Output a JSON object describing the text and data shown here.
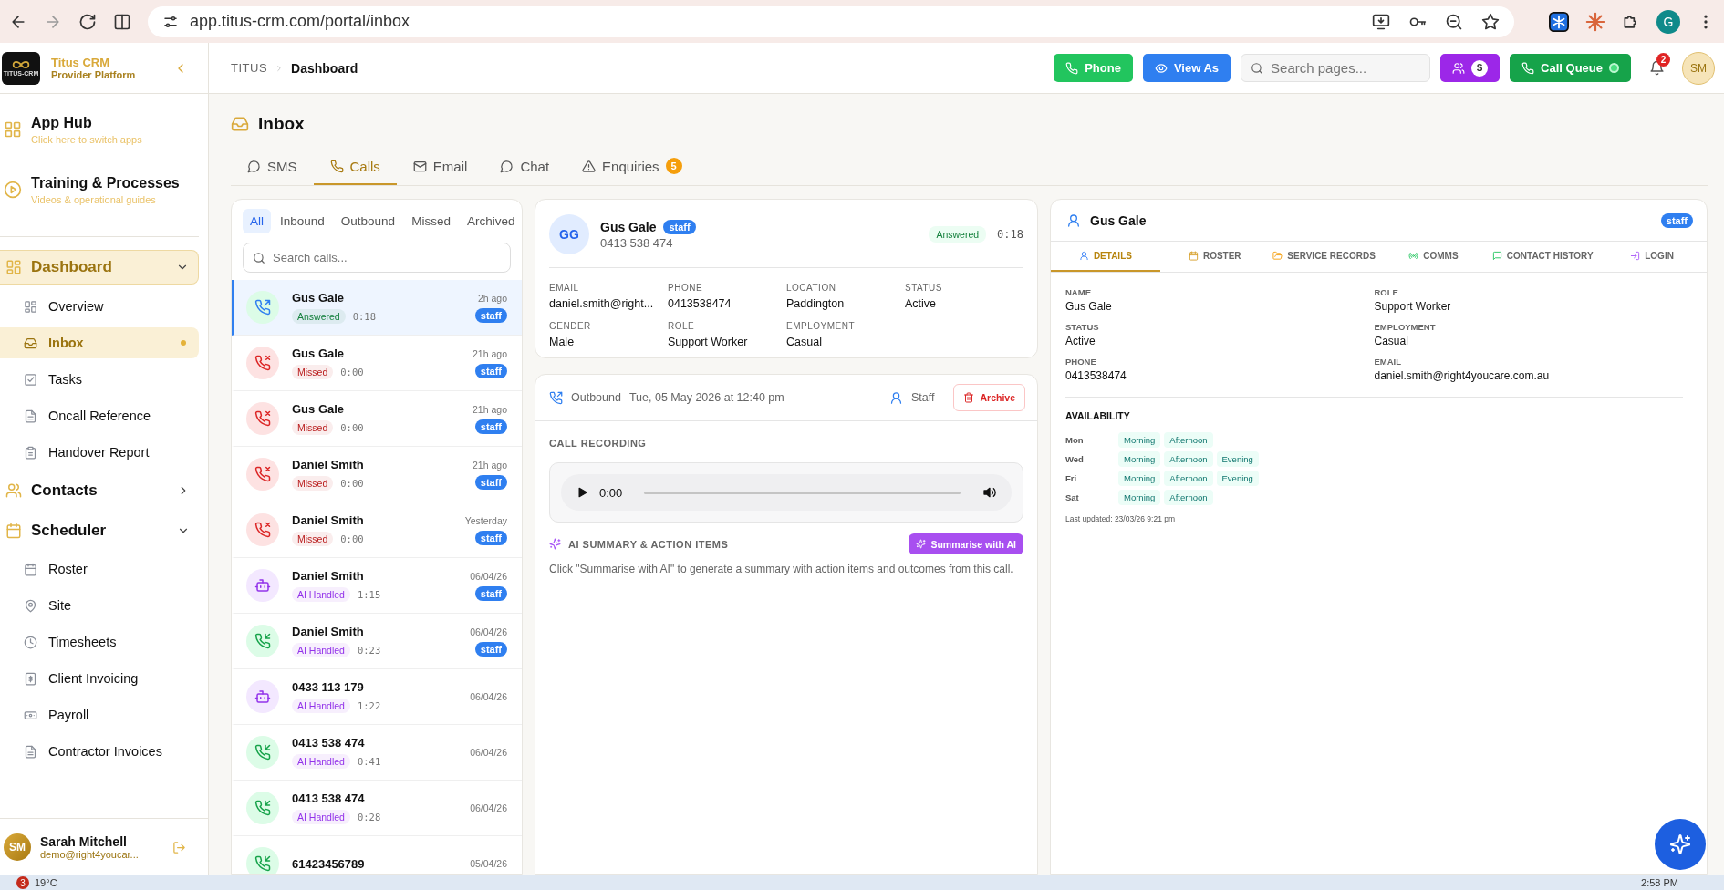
{
  "browser": {
    "url": "app.titus-crm.com/portal/inbox",
    "profile": "G"
  },
  "sidebar": {
    "logo_text": "TITUS-CRM",
    "brand": "Titus CRM",
    "subtitle": "Provider Platform",
    "apps": [
      {
        "title": "App Hub",
        "subtitle": "Click here to switch apps"
      },
      {
        "title": "Training & Processes",
        "subtitle": "Videos & operational guides"
      }
    ],
    "nav": [
      {
        "label": "Dashboard",
        "selected": true,
        "expanded": true,
        "children": [
          {
            "label": "Overview",
            "selected": false,
            "unread": false
          },
          {
            "label": "Inbox",
            "selected": true,
            "unread": true
          },
          {
            "label": "Tasks",
            "selected": false,
            "unread": false
          },
          {
            "label": "Oncall Reference",
            "selected": false,
            "unread": false
          },
          {
            "label": "Handover Report",
            "selected": false,
            "unread": false
          }
        ]
      },
      {
        "label": "Contacts",
        "selected": false,
        "expanded": false
      },
      {
        "label": "Scheduler",
        "selected": false,
        "expanded": true,
        "children": [
          {
            "label": "Roster",
            "selected": false,
            "unread": false
          },
          {
            "label": "Site",
            "selected": false,
            "unread": false
          },
          {
            "label": "Timesheets",
            "selected": false,
            "unread": false
          },
          {
            "label": "Client Invoicing",
            "selected": false,
            "unread": false
          },
          {
            "label": "Payroll",
            "selected": false,
            "unread": false
          },
          {
            "label": "Contractor Invoices",
            "selected": false,
            "unread": false
          }
        ]
      }
    ],
    "user": {
      "initials": "SM",
      "name": "Sarah Mitchell",
      "email": "demo@right4youcar..."
    }
  },
  "header": {
    "breadcrumb": [
      "TITUS",
      "Dashboard"
    ],
    "phone_button": "Phone",
    "view_as_button": "View As",
    "search": {
      "placeholder": "Search pages..."
    },
    "team_avatar": "S",
    "call_queue_button": "Call Queue",
    "notifications": "2",
    "avatar": "SM"
  },
  "page_title": "Inbox",
  "tabs": [
    {
      "label": "SMS",
      "selected": false
    },
    {
      "label": "Calls",
      "selected": true
    },
    {
      "label": "Email",
      "selected": false
    },
    {
      "label": "Chat",
      "selected": false
    },
    {
      "label": "Enquiries",
      "selected": false,
      "badge": "5"
    }
  ],
  "call_list": {
    "filters": [
      {
        "label": "All",
        "selected": true
      },
      {
        "label": "Inbound",
        "selected": false
      },
      {
        "label": "Outbound",
        "selected": false
      },
      {
        "label": "Missed",
        "selected": false
      },
      {
        "label": "Archived",
        "selected": false
      }
    ],
    "search": {
      "placeholder": "Search calls..."
    },
    "calls": [
      {
        "name": "Gus Gale",
        "kind": "outbound",
        "status": "Answered",
        "color": "#15803d",
        "duration": "0:18",
        "time": "2h ago",
        "tag": "staff",
        "selected": true
      },
      {
        "name": "Gus Gale",
        "kind": "missed",
        "status": "Missed",
        "color": "#b91c1c",
        "duration": "0:00",
        "time": "21h ago",
        "tag": "staff",
        "selected": false
      },
      {
        "name": "Gus Gale",
        "kind": "missed",
        "status": "Missed",
        "color": "#b91c1c",
        "duration": "0:00",
        "time": "21h ago",
        "tag": "staff",
        "selected": false
      },
      {
        "name": "Daniel Smith",
        "kind": "missed",
        "status": "Missed",
        "color": "#b91c1c",
        "duration": "0:00",
        "time": "21h ago",
        "tag": "staff",
        "selected": false
      },
      {
        "name": "Daniel Smith",
        "kind": "missed",
        "status": "Missed",
        "color": "#b91c1c",
        "duration": "0:00",
        "time": "Yesterday",
        "tag": "staff",
        "selected": false
      },
      {
        "name": "Daniel Smith",
        "kind": "ai",
        "status": "AI Handled",
        "color": "#9333ea",
        "duration": "1:15",
        "time": "06/04/26",
        "tag": "staff",
        "selected": false
      },
      {
        "name": "Daniel Smith",
        "kind": "inbound",
        "status": "AI Handled",
        "color": "#9333ea",
        "duration": "0:23",
        "time": "06/04/26",
        "tag": "staff",
        "selected": false
      },
      {
        "name": "0433 113 179",
        "kind": "ai",
        "status": "AI Handled",
        "color": "#9333ea",
        "duration": "1:22",
        "time": "06/04/26",
        "selected": false
      },
      {
        "name": "0413 538 474",
        "kind": "inbound",
        "status": "AI Handled",
        "color": "#9333ea",
        "duration": "0:41",
        "time": "06/04/26",
        "selected": false
      },
      {
        "name": "0413 538 474",
        "kind": "inbound",
        "status": "AI Handled",
        "color": "#9333ea",
        "duration": "0:28",
        "time": "06/04/26",
        "selected": false
      },
      {
        "name": "61423456789",
        "kind": "inbound",
        "time": "05/04/26",
        "selected": false
      }
    ]
  },
  "contact_card": {
    "initials": "GG",
    "name": "Gus Gale",
    "tag": "staff",
    "phone": "0413 538 474",
    "status": "Answered",
    "duration": "0:18",
    "fields": [
      {
        "label": "EMAIL",
        "value": "daniel.smith@right..."
      },
      {
        "label": "PHONE",
        "value": "0413538474"
      },
      {
        "label": "LOCATION",
        "value": "Paddington"
      },
      {
        "label": "STATUS",
        "value": "Active"
      },
      {
        "label": "GENDER",
        "value": "Male"
      },
      {
        "label": "ROLE",
        "value": "Support Worker"
      },
      {
        "label": "EMPLOYMENT",
        "value": "Casual"
      }
    ]
  },
  "call_detail": {
    "direction": "Outbound",
    "datetime": "Tue, 05 May 2026 at 12:40 pm",
    "contact_type": "Staff",
    "archive_button": "Archive",
    "recording_title": "CALL RECORDING",
    "player_time": "0:00",
    "ai_title": "AI SUMMARY & ACTION ITEMS",
    "ai_button": "Summarise with AI",
    "ai_hint": "Click \"Summarise with AI\" to generate a summary with action items and outcomes from this call."
  },
  "profile": {
    "name": "Gus Gale",
    "tag": "staff",
    "tabs": [
      {
        "label": "DETAILS",
        "selected": true
      },
      {
        "label": "ROSTER",
        "selected": false
      },
      {
        "label": "SERVICE RECORDS",
        "selected": false
      },
      {
        "label": "COMMS",
        "selected": false
      },
      {
        "label": "CONTACT HISTORY",
        "selected": false
      },
      {
        "label": "LOGIN",
        "selected": false
      }
    ],
    "fields": [
      {
        "label": "NAME",
        "value": "Gus Gale"
      },
      {
        "label": "ROLE",
        "value": "Support Worker"
      },
      {
        "label": "STATUS",
        "value": "Active"
      },
      {
        "label": "EMPLOYMENT",
        "value": "Casual"
      },
      {
        "label": "PHONE",
        "value": "0413538474"
      },
      {
        "label": "EMAIL",
        "value": "daniel.smith@right4youcare.com.au"
      }
    ],
    "availability_title": "AVAILABILITY",
    "availability": [
      {
        "day": "Mon",
        "slots": [
          "Morning",
          "Afternoon"
        ]
      },
      {
        "day": "Wed",
        "slots": [
          "Morning",
          "Afternoon",
          "Evening"
        ]
      },
      {
        "day": "Fri",
        "slots": [
          "Morning",
          "Afternoon",
          "Evening"
        ]
      },
      {
        "day": "Sat",
        "slots": [
          "Morning",
          "Afternoon"
        ]
      }
    ],
    "last_updated": "Last updated: 23/03/26 9:21 pm"
  },
  "taskbar": {
    "alert_badge": "3",
    "weather": "19°C",
    "time": "2:58 PM"
  }
}
